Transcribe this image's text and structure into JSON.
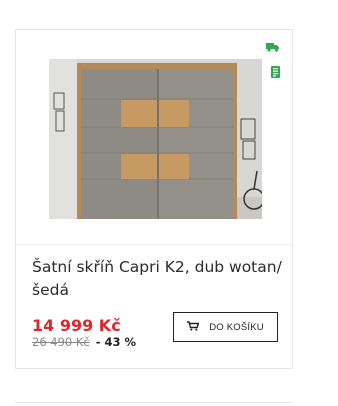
{
  "product": {
    "title": "Šatní skříň Capri K2, dub wotan/šedá",
    "price": "14 999 Kč",
    "old_price": "26 490 Kč",
    "discount": "- 43 %",
    "cart_label": "DO KOŠÍKU"
  },
  "icons": {
    "delivery": "delivery-truck-icon",
    "stock": "in-stock-icon",
    "cart": "cart-icon"
  },
  "colors": {
    "price": "#e1252b",
    "icon_green": "#2fa84f",
    "wardrobe_grey": "#8e8a84",
    "oak": "#c79a63"
  }
}
